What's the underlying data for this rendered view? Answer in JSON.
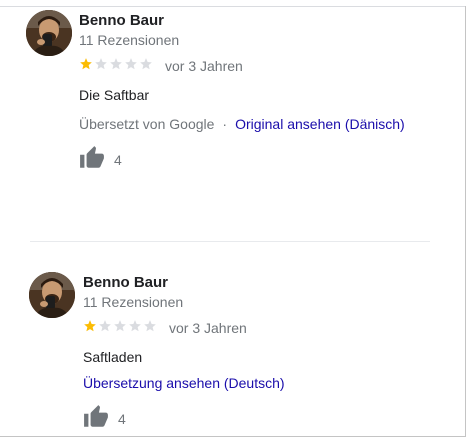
{
  "colors": {
    "star_filled": "#fbbc04",
    "star_empty": "#dadce0",
    "link": "#1a0dab",
    "muted": "#70757a",
    "icon": "#70757a"
  },
  "reviews": [
    {
      "author": "Benno Baur",
      "review_count": "11 Rezensionen",
      "rating": 1,
      "rating_max": 5,
      "date": "vor 3 Jahren",
      "text": "Die Saftbar",
      "translated_by": "Übersetzt von Google",
      "separator": "·",
      "original_link": "Original ansehen (Dänisch)",
      "likes": "4",
      "icons": {
        "avatar": "avatar-photo",
        "like": "thumbs-up-icon"
      }
    },
    {
      "author": "Benno Baur",
      "review_count": "11 Rezensionen",
      "rating": 1,
      "rating_max": 5,
      "date": "vor 3 Jahren",
      "text": "Saftladen",
      "translate_link": "Übersetzung ansehen (Deutsch)",
      "likes": "4",
      "icons": {
        "avatar": "avatar-photo",
        "like": "thumbs-up-icon"
      }
    }
  ]
}
